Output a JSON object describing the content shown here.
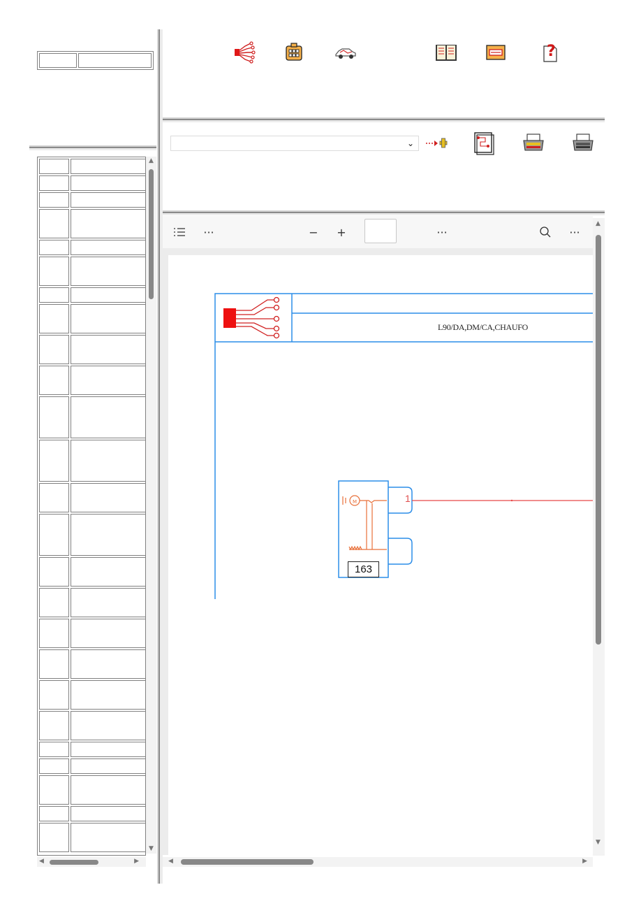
{
  "top_left": {
    "cell_a": "",
    "cell_b": ""
  },
  "toolbar": {
    "icons": [
      "wiring-harness-icon",
      "connector-icon",
      "vehicle-icon",
      "book-icon",
      "fuse-icon",
      "help-icon"
    ]
  },
  "selector": {
    "value": ""
  },
  "actions": {
    "icons": [
      "add-arrow-icon",
      "schematic-page-icon",
      "print-color-icon",
      "print-icon"
    ]
  },
  "viewer": {
    "toolbar": {
      "outline": "☰",
      "more1": "···",
      "zoom_out": "−",
      "zoom_in": "+",
      "page": "",
      "more2": "···",
      "search": "⌕",
      "more3": "···"
    },
    "diagram": {
      "header_caption": "L90/DA,DM/CA,CHAUFO",
      "component_number": "163",
      "pin_1": "1"
    }
  },
  "colors": {
    "frame_blue": "#2b8de8",
    "wire_red": "#e84848",
    "component_orange": "#e8703a"
  }
}
